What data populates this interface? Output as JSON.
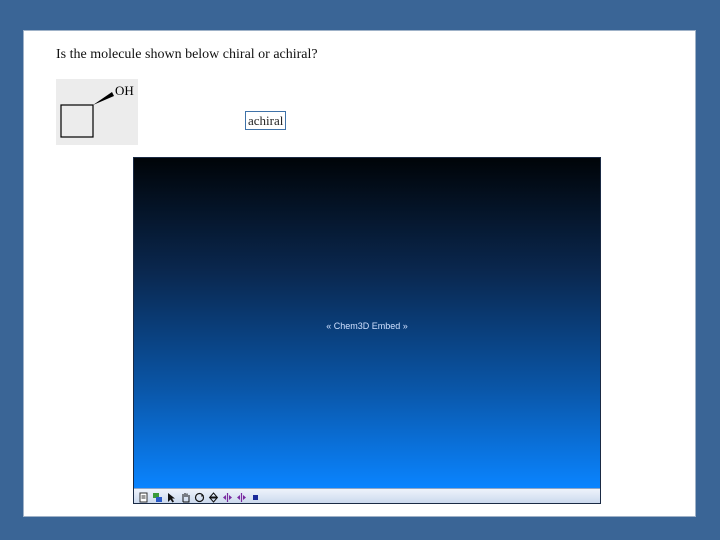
{
  "question": {
    "text": "Is the molecule shown below chiral or achiral?"
  },
  "molecule": {
    "substituent_label": "OH"
  },
  "answer": {
    "value": "achiral"
  },
  "viewer": {
    "embed_label": "« Chem3D Embed »",
    "toolbar_icons": [
      "document-icon",
      "layers-icon",
      "arrow-cursor-icon",
      "hand-icon",
      "rotate-icon",
      "rotate-axis-icon",
      "move-left-right-icon",
      "move-left-right-icon",
      "stop-icon"
    ],
    "colors": {
      "gradient_top": "#000408",
      "gradient_bottom": "#0a84ff"
    }
  }
}
